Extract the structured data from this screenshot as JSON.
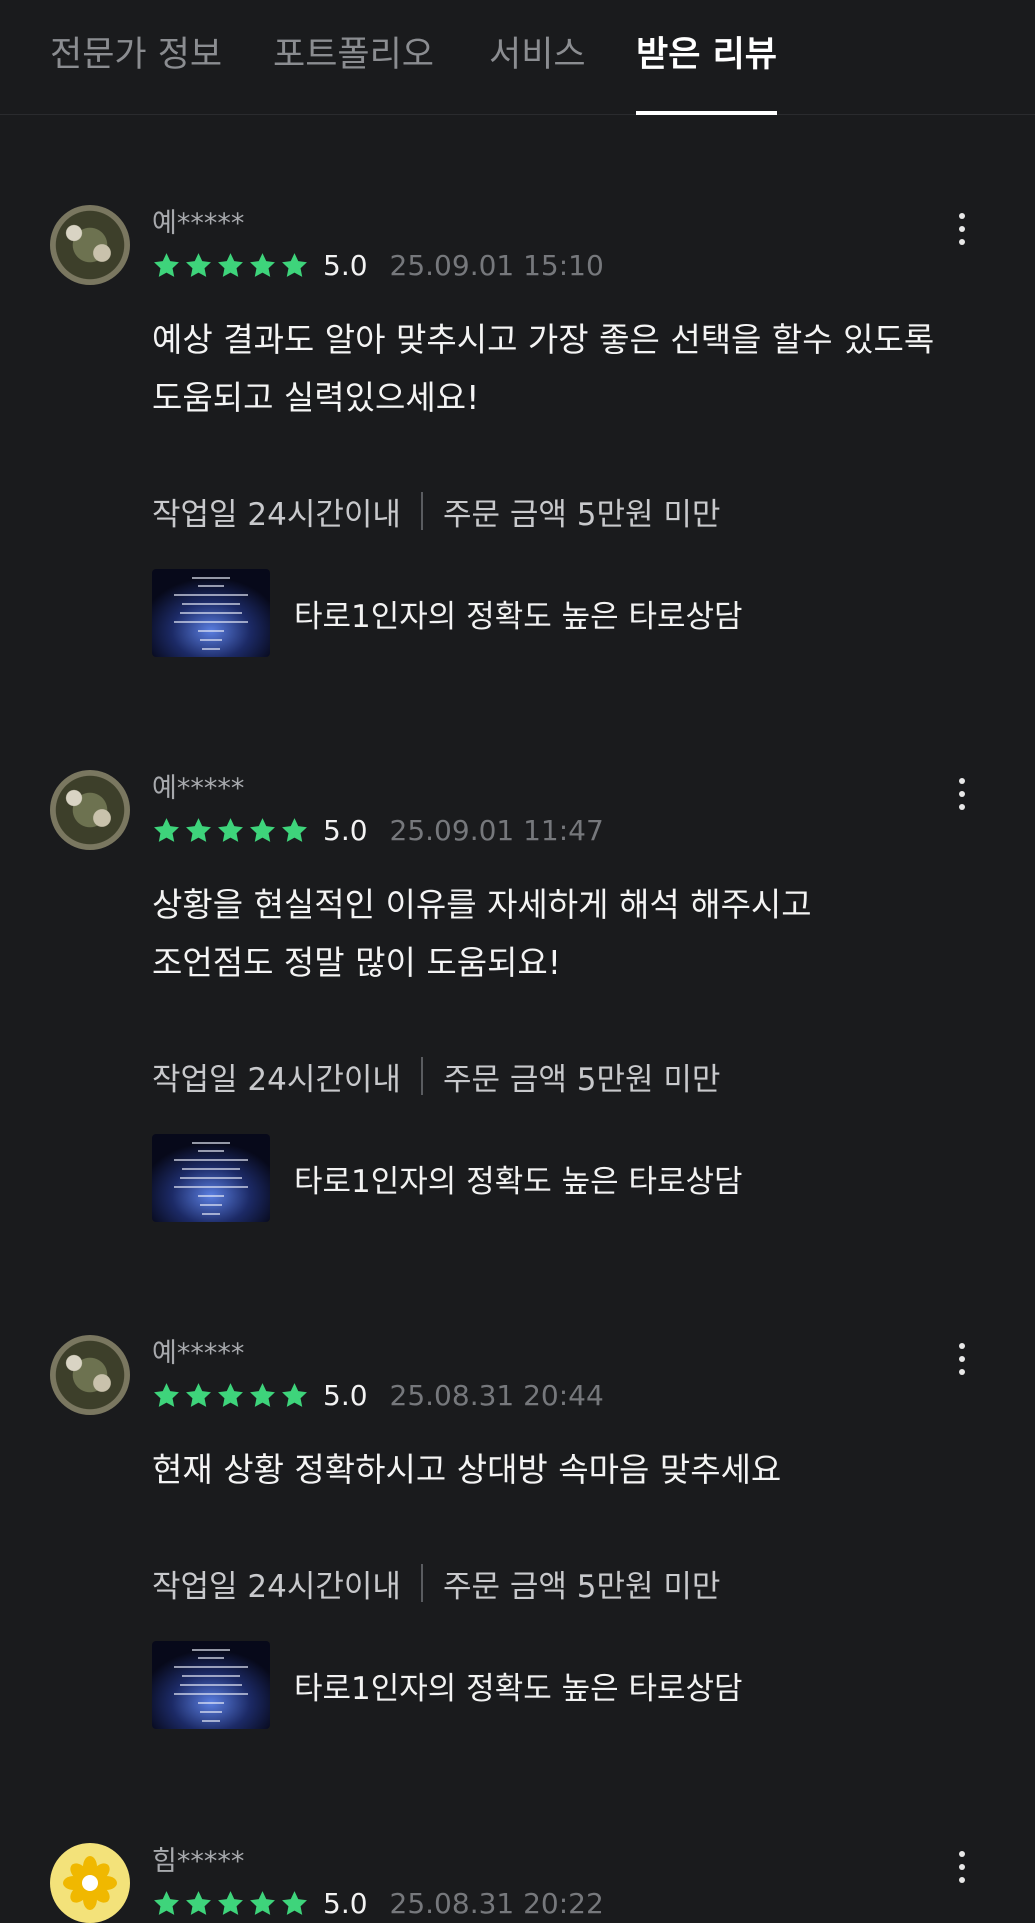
{
  "tabs": [
    {
      "label": "전문가 정보",
      "active": false
    },
    {
      "label": "포트폴리오",
      "active": false
    },
    {
      "label": "서비스",
      "active": false
    },
    {
      "label": "받은 리뷰",
      "active": true
    }
  ],
  "colors": {
    "background": "#1a1b1d",
    "star": "#3ed47b",
    "muted_text": "#76787c"
  },
  "reviews": [
    {
      "username": "예*****",
      "rating": 5,
      "score": "5.0",
      "date": "25.09.01 15:10",
      "comment": "예상 결과도 알아 맞추시고 가장 좋은 선택을 할수 있도록\n도움되고 실력있으세요!",
      "work_period": "작업일 24시간이내",
      "order_amount": "주문 금액 5만원 미만",
      "service_title": "타로1인자의 정확도 높은 타로상담"
    },
    {
      "username": "예*****",
      "rating": 5,
      "score": "5.0",
      "date": "25.09.01 11:47",
      "comment": "상황을 현실적인 이유를 자세하게 해석 해주시고\n조언점도 정말 많이 도움되요!",
      "work_period": "작업일 24시간이내",
      "order_amount": "주문 금액 5만원 미만",
      "service_title": "타로1인자의 정확도 높은 타로상담"
    },
    {
      "username": "예*****",
      "rating": 5,
      "score": "5.0",
      "date": "25.08.31 20:44",
      "comment": "현재 상황 정확하시고 상대방 속마음 맞추세요",
      "work_period": "작업일 24시간이내",
      "order_amount": "주문 금액 5만원 미만",
      "service_title": "타로1인자의 정확도 높은 타로상담"
    },
    {
      "username": "힘*****",
      "rating": 5,
      "score": "5.0",
      "date": "25.08.31 20:22"
    }
  ]
}
